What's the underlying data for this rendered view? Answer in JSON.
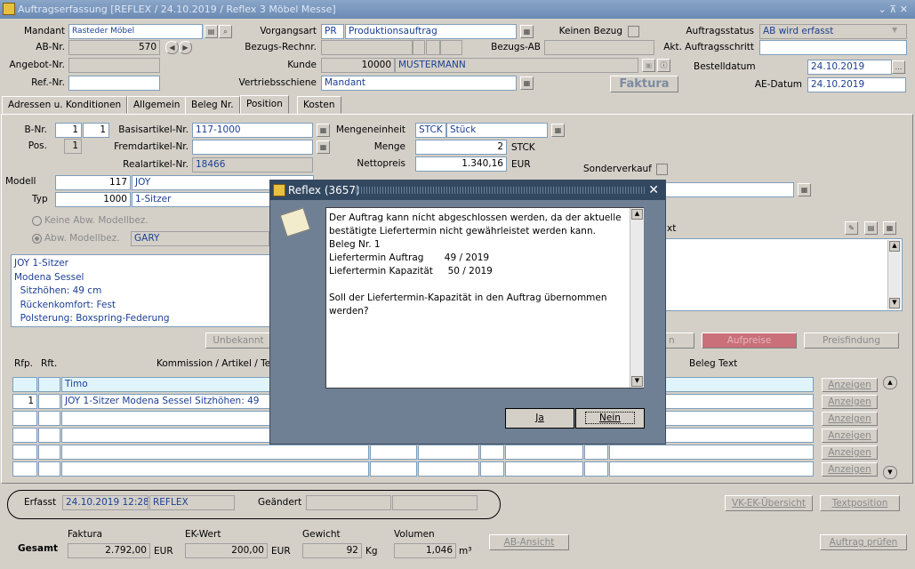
{
  "window": {
    "title": "Auftragserfassung  [REFLEX / 24.10.2019 / Reflex 3 Möbel Messe]",
    "controls": "⌄ ⊼ ✕"
  },
  "header": {
    "mandant_label": "Mandant",
    "mandant_value": "Rasteder Möbel",
    "ab_nr_label": "AB-Nr.",
    "ab_nr_value": "570",
    "angebot_label": "Angebot-Nr.",
    "angebot_value": "",
    "ref_label": "Ref.-Nr.",
    "ref_value": "",
    "vorgangsart_label": "Vorgangsart",
    "vorgangsart_code": "PR",
    "vorgangsart_value": "Produktionsauftrag",
    "keinen_bezug_label": "Keinen Bezug",
    "bezugs_rechnr_label": "Bezugs-Rechnr.",
    "bezugs_ab_label": "Bezugs-AB",
    "kunde_label": "Kunde",
    "kunde_nr": "10000",
    "kunde_name": "MUSTERMANN",
    "vertriebsschiene_label": "Vertriebsschiene",
    "vertriebsschiene_value": "Mandant",
    "faktura_label": "Faktura",
    "auftragsstatus_label": "Auftragsstatus",
    "auftragsstatus_value": "AB wird erfasst",
    "akt_schritt_label": "Akt. Auftragsschritt",
    "akt_schritt_value": "",
    "bestelldatum_label": "Bestelldatum",
    "bestelldatum_value": "24.10.2019",
    "ae_datum_label": "AE-Datum",
    "ae_datum_value": "24.10.2019"
  },
  "tabs": [
    "Adressen u. Konditionen",
    "Allgemein",
    "Beleg Nr.",
    "Position",
    "Kosten"
  ],
  "position": {
    "bnr_label": "B-Nr.",
    "bnr_1": "1",
    "bnr_2": "1",
    "pos_label": "Pos.",
    "pos_value": "1",
    "basis_label": "Basisartikel-Nr.",
    "basis_value": "117-1000",
    "fremd_label": "Fremdartikel-Nr.",
    "fremd_value": "",
    "real_label": "Realartikel-Nr.",
    "real_value": "18466",
    "modell_label": "Modell",
    "modell_nr": "117",
    "modell_name": "JOY",
    "typ_label": "Typ",
    "typ_nr": "1000",
    "typ_name": "1-Sitzer",
    "radio1": "Keine Abw. Modellbez.",
    "radio2": "Abw. Modellbez.",
    "abw_value": "GARY",
    "mengeneinheit_label": "Mengeneinheit",
    "me_code": "STCK",
    "me_name": "Stück",
    "menge_label": "Menge",
    "menge_value": "2",
    "menge_unit": "STCK",
    "nettopreis_label": "Nettopreis",
    "nettopreis_value": "1.340,16",
    "nettopreis_unit": "EUR",
    "sonderverkauf_label": "Sonderverkauf",
    "text_label": "xt",
    "description": "JOY 1-Sitzer\nModena Sessel\n  Sitzhöhen: 49 cm\n  Rückenkomfort: Fest\n  Polsterung: Boxspring-Federung",
    "btn_unbekannt": "Unbekannt",
    "btn_n": "n",
    "btn_aufpreise": "Aufpreise",
    "btn_preisfindung": "Preisfindung"
  },
  "grid": {
    "headers": {
      "rfp": "Rfp.",
      "rft": "Rft.",
      "kommission": "Kommission / Artikel / Text",
      "beleg_text": "Beleg Text"
    },
    "rows": [
      {
        "rfp": "",
        "text": "Timo"
      },
      {
        "rfp": "1",
        "text": "JOY 1-Sitzer Modena Sessel   Sitzhöhen: 49"
      },
      {
        "rfp": "",
        "text": ""
      },
      {
        "rfp": "",
        "text": ""
      },
      {
        "rfp": "",
        "text": ""
      },
      {
        "rfp": "",
        "text": ""
      }
    ],
    "anzeigen": "Anzeigen"
  },
  "footer": {
    "erfasst_label": "Erfasst",
    "erfasst_date": "24.10.2019 12:28",
    "erfasst_user": "REFLEX",
    "geaendert_label": "Geändert",
    "btn_vkek": "VK-EK-Übersicht",
    "btn_textposition": "Textposition",
    "gesamt_label": "Gesamt",
    "faktura_label": "Faktura",
    "faktura_value": "2.792,00",
    "faktura_unit": "EUR",
    "ekwert_label": "EK-Wert",
    "ekwert_value": "200,00",
    "ekwert_unit": "EUR",
    "gewicht_label": "Gewicht",
    "gewicht_value": "92",
    "gewicht_unit": "Kg",
    "volumen_label": "Volumen",
    "volumen_value": "1,046",
    "volumen_unit": "m³",
    "btn_ab_ansicht": "AB-Ansicht",
    "btn_auftrag_pruefen": "Auftrag prüfen"
  },
  "dialog": {
    "title": "Reflex (3657)",
    "message": "Der Auftrag kann nicht abgeschlossen werden, da der aktuelle bestätigte Liefertermin nicht gewährleistet werden kann.\nBeleg Nr. 1\nLiefertermin Auftrag       49 / 2019\nLiefertermin Kapazität     50 / 2019\n\nSoll der Liefertermin-Kapazität in den Auftrag übernommen werden?",
    "btn_ja": "Ja",
    "btn_nein": "Nein"
  },
  "colors": {
    "aufpreise_button": "#c9707a",
    "dialog_title": "#324861",
    "dialog_body": "#6f7f94",
    "selected_row": "#e0f4fb"
  }
}
